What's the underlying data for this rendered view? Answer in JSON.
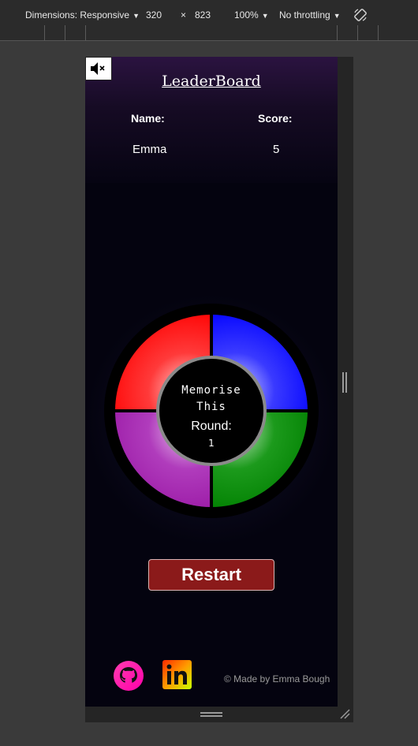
{
  "devtools": {
    "dimensions_label": "Dimensions: Responsive",
    "width": "320",
    "times": "×",
    "height": "823",
    "zoom": "100%",
    "throttling": "No throttling"
  },
  "app": {
    "mute_icon": "speaker-muted-icon",
    "leaderboard": {
      "title": "LeaderBoard",
      "name_header": "Name:",
      "score_header": "Score:",
      "rows": [
        {
          "name": "Emma",
          "score": "5"
        }
      ]
    },
    "game": {
      "memorise_line1": "Memorise",
      "memorise_line2": "This",
      "round_label": "Round:",
      "round_value": "1",
      "colors": {
        "red": "#ff0000",
        "blue": "#0000ff",
        "purple": "#9b1aa6",
        "green": "#008000"
      }
    },
    "restart_label": "Restart",
    "footer": {
      "github_icon": "github-icon",
      "linkedin_icon": "linkedin-icon",
      "credit": "© Made by Emma Bough"
    }
  }
}
